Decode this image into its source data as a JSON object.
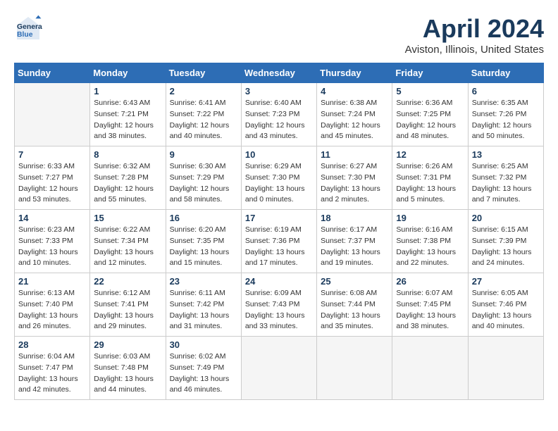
{
  "header": {
    "logo_line1": "General",
    "logo_line2": "Blue",
    "month_title": "April 2024",
    "location": "Aviston, Illinois, United States"
  },
  "weekdays": [
    "Sunday",
    "Monday",
    "Tuesday",
    "Wednesday",
    "Thursday",
    "Friday",
    "Saturday"
  ],
  "weeks": [
    [
      {
        "day": null,
        "info": null
      },
      {
        "day": "1",
        "info": "Sunrise: 6:43 AM\nSunset: 7:21 PM\nDaylight: 12 hours\nand 38 minutes."
      },
      {
        "day": "2",
        "info": "Sunrise: 6:41 AM\nSunset: 7:22 PM\nDaylight: 12 hours\nand 40 minutes."
      },
      {
        "day": "3",
        "info": "Sunrise: 6:40 AM\nSunset: 7:23 PM\nDaylight: 12 hours\nand 43 minutes."
      },
      {
        "day": "4",
        "info": "Sunrise: 6:38 AM\nSunset: 7:24 PM\nDaylight: 12 hours\nand 45 minutes."
      },
      {
        "day": "5",
        "info": "Sunrise: 6:36 AM\nSunset: 7:25 PM\nDaylight: 12 hours\nand 48 minutes."
      },
      {
        "day": "6",
        "info": "Sunrise: 6:35 AM\nSunset: 7:26 PM\nDaylight: 12 hours\nand 50 minutes."
      }
    ],
    [
      {
        "day": "7",
        "info": "Sunrise: 6:33 AM\nSunset: 7:27 PM\nDaylight: 12 hours\nand 53 minutes."
      },
      {
        "day": "8",
        "info": "Sunrise: 6:32 AM\nSunset: 7:28 PM\nDaylight: 12 hours\nand 55 minutes."
      },
      {
        "day": "9",
        "info": "Sunrise: 6:30 AM\nSunset: 7:29 PM\nDaylight: 12 hours\nand 58 minutes."
      },
      {
        "day": "10",
        "info": "Sunrise: 6:29 AM\nSunset: 7:30 PM\nDaylight: 13 hours\nand 0 minutes."
      },
      {
        "day": "11",
        "info": "Sunrise: 6:27 AM\nSunset: 7:30 PM\nDaylight: 13 hours\nand 2 minutes."
      },
      {
        "day": "12",
        "info": "Sunrise: 6:26 AM\nSunset: 7:31 PM\nDaylight: 13 hours\nand 5 minutes."
      },
      {
        "day": "13",
        "info": "Sunrise: 6:25 AM\nSunset: 7:32 PM\nDaylight: 13 hours\nand 7 minutes."
      }
    ],
    [
      {
        "day": "14",
        "info": "Sunrise: 6:23 AM\nSunset: 7:33 PM\nDaylight: 13 hours\nand 10 minutes."
      },
      {
        "day": "15",
        "info": "Sunrise: 6:22 AM\nSunset: 7:34 PM\nDaylight: 13 hours\nand 12 minutes."
      },
      {
        "day": "16",
        "info": "Sunrise: 6:20 AM\nSunset: 7:35 PM\nDaylight: 13 hours\nand 15 minutes."
      },
      {
        "day": "17",
        "info": "Sunrise: 6:19 AM\nSunset: 7:36 PM\nDaylight: 13 hours\nand 17 minutes."
      },
      {
        "day": "18",
        "info": "Sunrise: 6:17 AM\nSunset: 7:37 PM\nDaylight: 13 hours\nand 19 minutes."
      },
      {
        "day": "19",
        "info": "Sunrise: 6:16 AM\nSunset: 7:38 PM\nDaylight: 13 hours\nand 22 minutes."
      },
      {
        "day": "20",
        "info": "Sunrise: 6:15 AM\nSunset: 7:39 PM\nDaylight: 13 hours\nand 24 minutes."
      }
    ],
    [
      {
        "day": "21",
        "info": "Sunrise: 6:13 AM\nSunset: 7:40 PM\nDaylight: 13 hours\nand 26 minutes."
      },
      {
        "day": "22",
        "info": "Sunrise: 6:12 AM\nSunset: 7:41 PM\nDaylight: 13 hours\nand 29 minutes."
      },
      {
        "day": "23",
        "info": "Sunrise: 6:11 AM\nSunset: 7:42 PM\nDaylight: 13 hours\nand 31 minutes."
      },
      {
        "day": "24",
        "info": "Sunrise: 6:09 AM\nSunset: 7:43 PM\nDaylight: 13 hours\nand 33 minutes."
      },
      {
        "day": "25",
        "info": "Sunrise: 6:08 AM\nSunset: 7:44 PM\nDaylight: 13 hours\nand 35 minutes."
      },
      {
        "day": "26",
        "info": "Sunrise: 6:07 AM\nSunset: 7:45 PM\nDaylight: 13 hours\nand 38 minutes."
      },
      {
        "day": "27",
        "info": "Sunrise: 6:05 AM\nSunset: 7:46 PM\nDaylight: 13 hours\nand 40 minutes."
      }
    ],
    [
      {
        "day": "28",
        "info": "Sunrise: 6:04 AM\nSunset: 7:47 PM\nDaylight: 13 hours\nand 42 minutes."
      },
      {
        "day": "29",
        "info": "Sunrise: 6:03 AM\nSunset: 7:48 PM\nDaylight: 13 hours\nand 44 minutes."
      },
      {
        "day": "30",
        "info": "Sunrise: 6:02 AM\nSunset: 7:49 PM\nDaylight: 13 hours\nand 46 minutes."
      },
      {
        "day": null,
        "info": null
      },
      {
        "day": null,
        "info": null
      },
      {
        "day": null,
        "info": null
      },
      {
        "day": null,
        "info": null
      }
    ]
  ]
}
